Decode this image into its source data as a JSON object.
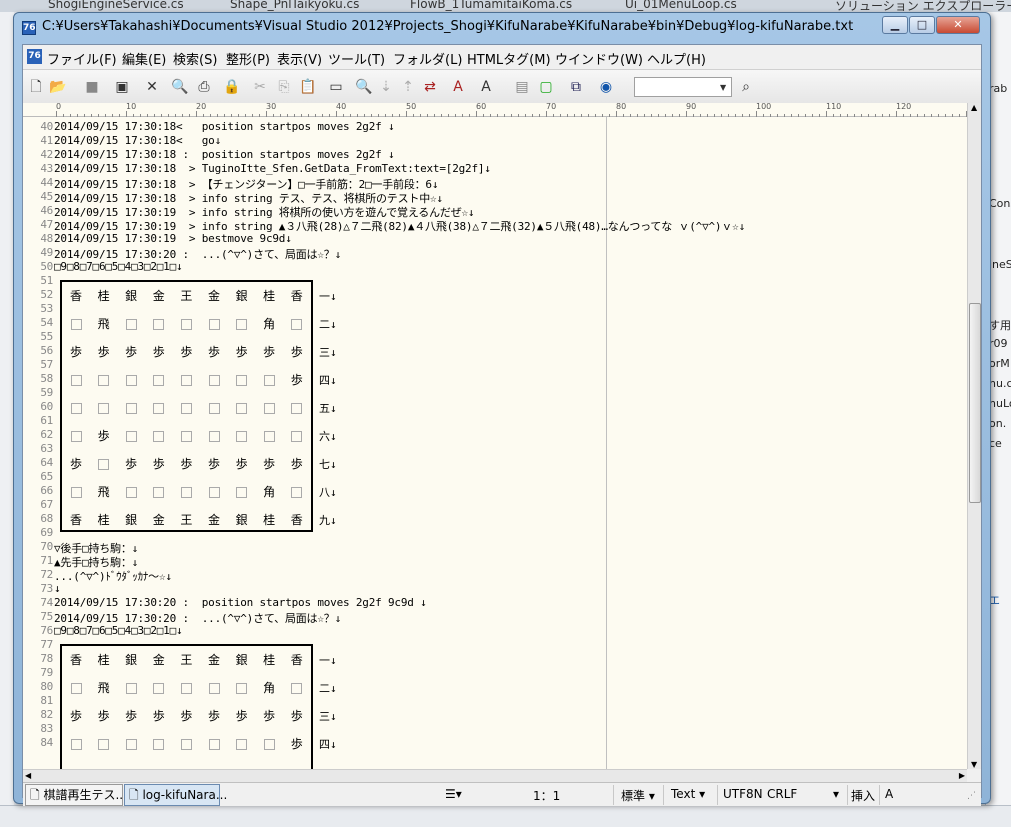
{
  "bg_tabs": [
    "ShogiEngineService.cs",
    "Shape_PnlTaikyoku.cs",
    "FlowB_1TumamitaiKoma.cs",
    "Ui_01MenuLoop.cs",
    "ソリューション エクスプローラー"
  ],
  "bg_right_snips": [
    "rab",
    "Cons",
    "ineS",
    "す用",
    "r09",
    "orM",
    "nu.c",
    "nuLo",
    "on.",
    "ce",
    "エ"
  ],
  "title": "C:¥Users¥Takahashi¥Documents¥Visual Studio 2012¥Projects_Shogi¥KifuNarabe¥KifuNarabe¥bin¥Debug¥log-kifuNarabe.txt",
  "menu": [
    "ファイル(F)",
    "編集(E)",
    "検索(S)",
    "整形(P)",
    "表示(V)",
    "ツール(T)",
    "フォルダ(L)",
    "HTMLタグ(M)",
    "ウインドウ(W)",
    "ヘルプ(H)"
  ],
  "ruler_labels": [
    "0",
    "10",
    "20",
    "30",
    "40",
    "50",
    "60",
    "70",
    "80",
    "90",
    "100",
    "110",
    "120"
  ],
  "lines_a": [
    {
      "n": "40",
      "t": "2014/09/15 17:30:18<   position startpos moves 2g2f ↓"
    },
    {
      "n": "41",
      "t": "2014/09/15 17:30:18<   go↓"
    },
    {
      "n": "42",
      "t": "2014/09/15 17:30:18 :  position startpos moves 2g2f ↓"
    },
    {
      "n": "43",
      "t": "2014/09/15 17:30:18  > TuginoItte_Sfen.GetData_FromText:text=[2g2f]↓"
    },
    {
      "n": "44",
      "t": "2014/09/15 17:30:18  > 【チェンジターン】□一手前筋：2□一手前段：6↓"
    },
    {
      "n": "45",
      "t": "2014/09/15 17:30:18  > info string テス、テス、将棋所のテスト中☆↓"
    },
    {
      "n": "46",
      "t": "2014/09/15 17:30:19  > info string 将棋所の使い方を遊んで覚えるんだぜ☆↓"
    },
    {
      "n": "47",
      "t": "2014/09/15 17:30:19  > info string ▲３八飛(28)△７二飛(82)▲４八飛(38)△７二飛(32)▲５八飛(48)…なんつってな ｖ(^▽^)ｖ☆↓"
    },
    {
      "n": "48",
      "t": "2014/09/15 17:30:19  > bestmove 9c9d↓"
    },
    {
      "n": "49",
      "t": "2014/09/15 17:30:20 :  ...(^▽^)さて、局面は☆？↓"
    },
    {
      "n": "50",
      "t": "□9□8□7□6□5□4□3□2□1□↓"
    }
  ],
  "board1_rows": [
    {
      "n": "52",
      "cells": [
        "香",
        "桂",
        "銀",
        "金",
        "王",
        "金",
        "銀",
        "桂",
        "香"
      ],
      "lab": "一↓"
    },
    {
      "n": "54",
      "cells": [
        "",
        "飛",
        "",
        "",
        "",
        "",
        "",
        "角",
        ""
      ],
      "lab": "二↓"
    },
    {
      "n": "56",
      "cells": [
        "歩",
        "歩",
        "歩",
        "歩",
        "歩",
        "歩",
        "歩",
        "歩",
        "歩"
      ],
      "lab": "三↓"
    },
    {
      "n": "58",
      "cells": [
        "",
        "",
        "",
        "",
        "",
        "",
        "",
        "",
        "歩"
      ],
      "lab": "四↓"
    },
    {
      "n": "60",
      "cells": [
        "",
        "",
        "",
        "",
        "",
        "",
        "",
        "",
        ""
      ],
      "lab": "五↓"
    },
    {
      "n": "62",
      "cells": [
        "",
        "歩",
        "",
        "",
        "",
        "",
        "",
        "",
        ""
      ],
      "lab": "六↓"
    },
    {
      "n": "64",
      "cells": [
        "歩",
        "",
        "歩",
        "歩",
        "歩",
        "歩",
        "歩",
        "歩",
        "歩"
      ],
      "lab": "七↓"
    },
    {
      "n": "66",
      "cells": [
        "",
        "飛",
        "",
        "",
        "",
        "",
        "",
        "角",
        ""
      ],
      "lab": "八↓"
    },
    {
      "n": "68",
      "cells": [
        "香",
        "桂",
        "銀",
        "金",
        "王",
        "金",
        "銀",
        "桂",
        "香"
      ],
      "lab": "九↓"
    }
  ],
  "board_odd_rows": [
    "51",
    "53",
    "55",
    "57",
    "59",
    "61",
    "63",
    "65",
    "67",
    "69"
  ],
  "lines_b": [
    {
      "n": "70",
      "t": "▽後手□持ち駒：↓"
    },
    {
      "n": "71",
      "t": "▲先手□持ち駒：↓"
    },
    {
      "n": "72",
      "t": "...(^▽^)ﾄﾞｳﾀﾞｯｶﾅ～☆↓"
    },
    {
      "n": "73",
      "t": "↓"
    },
    {
      "n": "74",
      "t": "2014/09/15 17:30:20 :  position startpos moves 2g2f 9c9d ↓"
    },
    {
      "n": "75",
      "t": "2014/09/15 17:30:20 :  ...(^▽^)さて、局面は☆？↓"
    },
    {
      "n": "76",
      "t": "□9□8□7□6□5□4□3□2□1□↓"
    }
  ],
  "board2_rows": [
    {
      "n": "78",
      "cells": [
        "香",
        "桂",
        "銀",
        "金",
        "王",
        "金",
        "銀",
        "桂",
        "香"
      ],
      "lab": "一↓"
    },
    {
      "n": "80",
      "cells": [
        "",
        "飛",
        "",
        "",
        "",
        "",
        "",
        "角",
        ""
      ],
      "lab": "二↓"
    },
    {
      "n": "82",
      "cells": [
        "歩",
        "歩",
        "歩",
        "歩",
        "歩",
        "歩",
        "歩",
        "歩",
        "歩"
      ],
      "lab": "三↓"
    },
    {
      "n": "84",
      "cells": [
        "",
        "",
        "",
        "",
        "",
        "",
        "",
        "",
        "歩"
      ],
      "lab": "四↓"
    }
  ],
  "board2_odd_rows": [
    "77",
    "79",
    "81",
    "83"
  ],
  "status": {
    "tab1": "棋譜再生テス...",
    "tab2": "log-kifuNara...",
    "position": "1：1",
    "mode": "標準",
    "type": "Text",
    "encoding": "UTF8N",
    "newline": "CRLF",
    "insert": "挿入",
    "a": "A"
  }
}
